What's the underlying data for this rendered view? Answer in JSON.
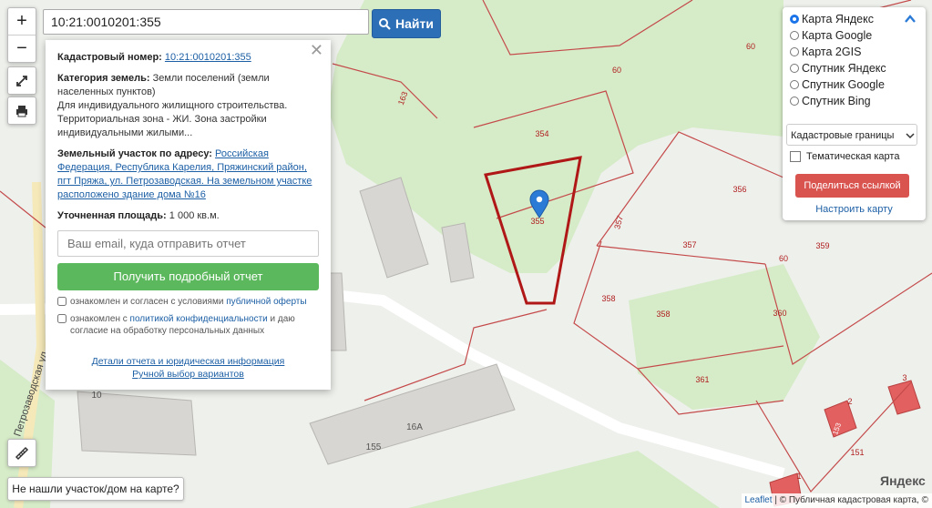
{
  "search": {
    "value": "10:21:0010201:355",
    "button_label": "Найти"
  },
  "zoom": {
    "in_label": "+",
    "out_label": "−"
  },
  "info_popup": {
    "cadastral_label": "Кадастровый номер:",
    "cadastral_value": "10:21:0010201:355",
    "category_label": "Категория земель:",
    "category_text": "Земли поселений (земли населенных пунктов)",
    "usage_text": "Для индивидуального жилищного строительства. Территориальная зона - ЖИ. Зона застройки индивидуальными жилыми...",
    "address_label": "Земельный участок по адресу:",
    "address_value": "Российская Федерация, Республика Карелия, Пряжинский район, пгт Пряжа, ул. Петрозаводская. На земельном участке расположено здание дома №16",
    "area_label": "Уточненная площадь:",
    "area_value": "1 000 кв.м.",
    "email_placeholder": "Ваш email, куда отправить отчет",
    "report_button": "Получить подробный отчет",
    "agree1_prefix": "ознакомлен и согласен с условиями",
    "agree1_link": "публичной оферты",
    "agree2_prefix": "ознакомлен с",
    "agree2_link": "политикой конфиденциальности",
    "agree2_suffix": "и даю согласие на обработку персональных данных",
    "details_link": "Детали отчета и юридическая информация",
    "manual_link": "Ручной выбор вариантов"
  },
  "layers": {
    "options": [
      "Карта Яндекс",
      "Карта Google",
      "Карта 2GIS",
      "Спутник Яндекс",
      "Спутник Google",
      "Спутник Bing"
    ],
    "selected": "Карта Яндекс",
    "select_value": "Кадастровые границы",
    "thematic_label": "Тематическая карта",
    "share_button": "Поделиться ссылкой",
    "setup_link": "Настроить карту"
  },
  "map_labels": {
    "parcels": [
      "354",
      "355",
      "356",
      "357",
      "358",
      "359",
      "360",
      "361",
      "60",
      "163",
      "151",
      "1",
      "2",
      "3"
    ],
    "house_labels": [
      "16А",
      "10",
      "155",
      "153"
    ],
    "street": "Петрозаводская ул."
  },
  "not_found": "Не нашли участок/дом на карте?",
  "attribution": {
    "leaflet": "Leaflet",
    "separator": "|",
    "copy": "© Публичная кадастровая карта, ©"
  },
  "yandex_logo": "Яндекс",
  "colors": {
    "search_button": "#2d6fb7",
    "report_button": "#5cb85c",
    "share_button": "#d9534f",
    "parcel_highlight": "#b01818",
    "marker": "#2b7bd6"
  }
}
